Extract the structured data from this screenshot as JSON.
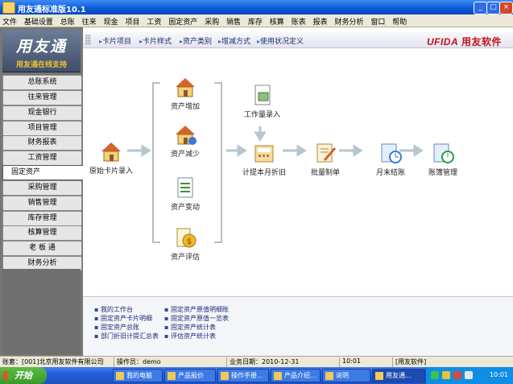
{
  "window": {
    "title": "用友通标准版10.1"
  },
  "menu": [
    "文件",
    "基础设置",
    "总账",
    "往来",
    "现金",
    "项目",
    "工资",
    "固定资产",
    "采购",
    "销售",
    "库存",
    "核算",
    "账表",
    "报表",
    "财务分析",
    "窗口",
    "帮助"
  ],
  "sidebar": {
    "logo_title": "用友通",
    "logo_subtitle": "用友通在线支持",
    "items": [
      "总账系统",
      "往来管理",
      "现金银行",
      "项目管理",
      "财务报表",
      "工资管理",
      "固定资产",
      "采购管理",
      "销售管理",
      "库存管理",
      "核算管理",
      "老 板 通",
      "财务分析"
    ],
    "active_index": 6
  },
  "toolbar": {
    "buttons": [
      "卡片项目",
      "卡片样式",
      "资产类别",
      "增减方式",
      "使用状况定义"
    ],
    "brand_en": "UFIDA",
    "brand_cn": "用友软件"
  },
  "flow": {
    "start": "原始卡片录入",
    "branch": [
      "资产增加",
      "资产减少",
      "资产变动",
      "资产评估"
    ],
    "workload": "工作量录入",
    "depreciation": "计提本月折旧",
    "voucher": "批量制单",
    "closing": "月末结账",
    "ledger": "账簿管理"
  },
  "quick_links": {
    "col1": [
      "我的工作台",
      "固定资产卡片明细",
      "固定资产总账",
      "部门折旧计提汇总表"
    ],
    "col2": [
      "固定资产原值明细账",
      "固定资产原值一览表",
      "固定资产统计表",
      "评估资产统计表"
    ]
  },
  "statusbar": {
    "company": "账套：[001]北京用友软件有限公司",
    "operator": "操作员：demo",
    "date": "业务日期：2010-12-31",
    "extra": "10:01",
    "product": "[用友软件]"
  },
  "taskbar": {
    "start": "开始",
    "tasks": [
      "我的电脑",
      "产品报价",
      "操作手册...",
      "产品介绍...",
      "说明",
      "用友通..."
    ],
    "active_index": 5,
    "clock": "10:01"
  }
}
